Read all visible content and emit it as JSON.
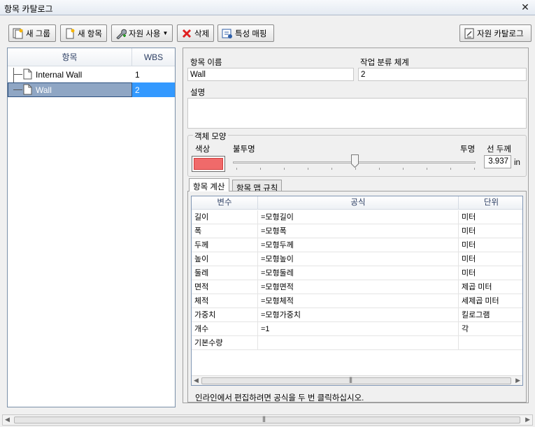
{
  "window": {
    "title": "항목 카탈로그"
  },
  "toolbar": {
    "new_group": "새 그룹",
    "new_item": "새 항목",
    "use_resource": "자원 사용",
    "delete": "삭제",
    "property_mapping": "특성 매핑",
    "resource_catalog": "자원 카탈로그"
  },
  "tree": {
    "col_item": "항목",
    "col_wbs": "WBS",
    "rows": [
      {
        "name": "Internal Wall",
        "wbs": "1"
      },
      {
        "name": "Wall",
        "wbs": "2"
      }
    ]
  },
  "detail": {
    "item_name_label": "항목 이름",
    "item_name_value": "Wall",
    "wbs_label": "작업 분류 체계",
    "wbs_value": "2",
    "desc_label": "설명",
    "desc_value": "",
    "appearance_group": "객체 모양",
    "color_label": "색상",
    "opaque_label": "불투명",
    "transparent_label": "투명",
    "line_thickness_label": "선 두께",
    "line_thickness_value": "3.937",
    "unit_in": "in",
    "transparency_fraction": 0.5,
    "color_hex": "#f06a6a"
  },
  "tabs": [
    {
      "label": "항목 계산",
      "active": true
    },
    {
      "label": "항목 맵 규칙",
      "active": false
    }
  ],
  "calc_grid": {
    "headers": [
      "변수",
      "공식",
      "단위"
    ],
    "rows": [
      [
        "길이",
        "=모형길이",
        "미터"
      ],
      [
        "폭",
        "=모형폭",
        "미터"
      ],
      [
        "두께",
        "=모형두께",
        "미터"
      ],
      [
        "높이",
        "=모형높이",
        "미터"
      ],
      [
        "둘레",
        "=모형둘레",
        "미터"
      ],
      [
        "면적",
        "=모형면적",
        "제곱 미터"
      ],
      [
        "체적",
        "=모형체적",
        "세제곱 미터"
      ],
      [
        "가중치",
        "=모형가중치",
        "킬로그램"
      ],
      [
        "개수",
        "=1",
        "각"
      ],
      [
        "기본수량",
        "",
        ""
      ]
    ],
    "hint": "인라인에서 편집하려면 공식을 두 번 클릭하십시오."
  }
}
